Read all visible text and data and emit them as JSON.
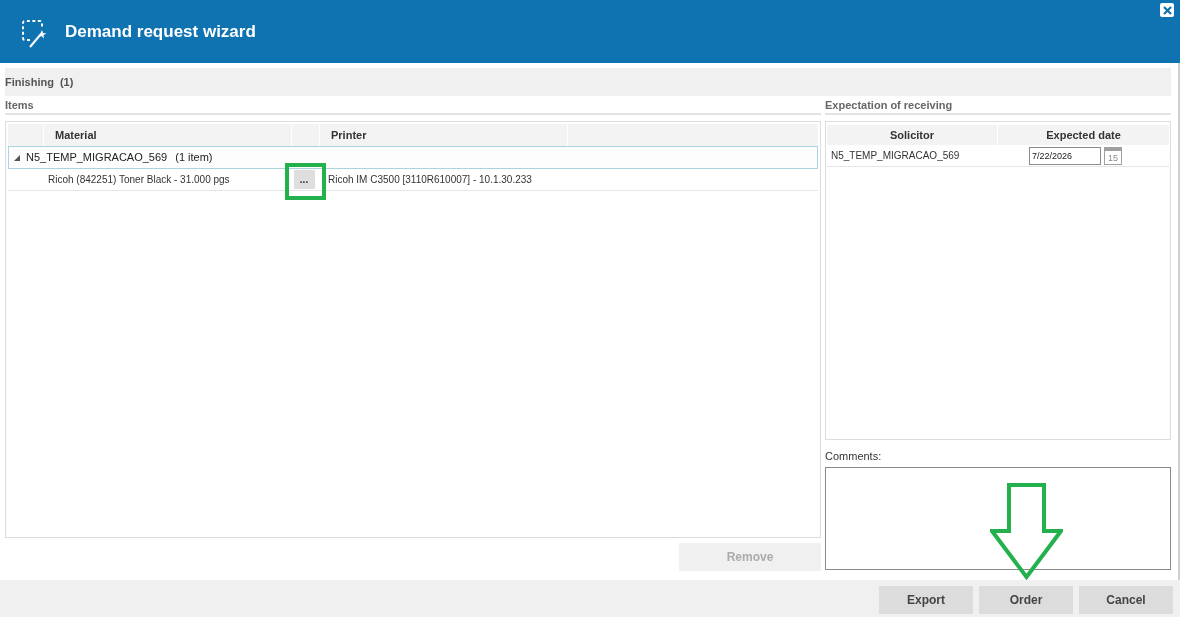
{
  "window": {
    "title": "Demand request wizard"
  },
  "step": {
    "label": "Finishing",
    "count": "(1)"
  },
  "items": {
    "title": "Items",
    "columns": [
      "Material",
      "Printer"
    ],
    "groups": [
      {
        "name": "N5_TEMP_MIGRACAO_569",
        "count": "(1 item)",
        "expanded": true,
        "selected": true,
        "rows": [
          {
            "material": "Ricoh (842251) Toner Black - 31.000 pgs",
            "action": "...",
            "highlighted": true,
            "printer": "Ricoh IM C3500 [3110R610007] - 10.1.30.233"
          }
        ]
      }
    ]
  },
  "remove": {
    "label": "Remove",
    "disabled": true
  },
  "expectation": {
    "title": "Expectation of receiving",
    "columns": [
      "Solicitor",
      "Expected date"
    ],
    "rows": [
      {
        "solicitor": "N5_TEMP_MIGRACAO_569",
        "expected_date": "7/22/2026",
        "calendar_day": "15"
      }
    ]
  },
  "comments": {
    "label": "Comments:"
  },
  "footer": {
    "buttons": [
      {
        "label": "Export",
        "pointed": false
      },
      {
        "label": "Order",
        "pointed": true
      },
      {
        "label": "Cancel",
        "pointed": false
      }
    ]
  }
}
